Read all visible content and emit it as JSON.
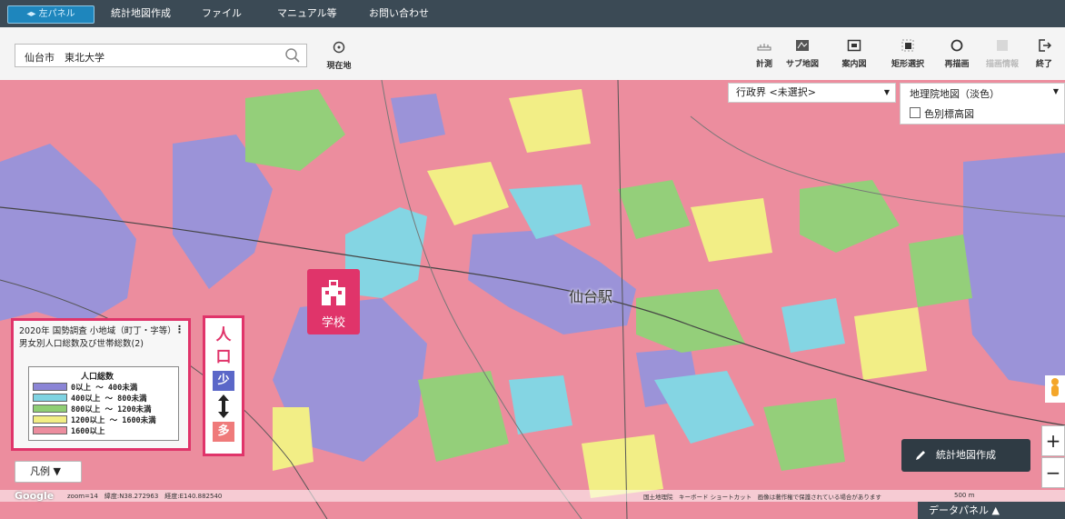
{
  "menu": {
    "left_panel": "◂▸ 左パネル",
    "items": [
      "統計地図作成",
      "ファイル",
      "マニュアル等",
      "お問い合わせ"
    ]
  },
  "search": {
    "value": "仙台市　東北大学",
    "current_location": "現在地"
  },
  "tools": [
    "計測",
    "サブ地図",
    "案内図",
    "矩形選択",
    "再描画",
    "描画情報",
    "終了"
  ],
  "map": {
    "admin_select": "行政界 <未選択>",
    "basemap_select": "地理院地図（淡色）",
    "checkbox_label": "色別標高図",
    "station_label": "仙台駅",
    "school_label": "学校"
  },
  "legend": {
    "title": "2020年 国勢調査 小地域（町丁・字等）男女別人口総数及び世帯総数(2)",
    "heading": "人口総数",
    "rows": [
      {
        "label": "0以上 ～ 400未満",
        "color": "#8b85d6"
      },
      {
        "label": "400以上 ～ 800未満",
        "color": "#7fd3e2"
      },
      {
        "label": "800以上 ～ 1200未満",
        "color": "#8fce74"
      },
      {
        "label": "1200以上 ～ 1600未満",
        "color": "#f2ee84"
      },
      {
        "label": "1600以上",
        "color": "#ec8d9e"
      }
    ],
    "toggle": "凡例 ▼"
  },
  "population_annotation": {
    "chars": [
      "人",
      "口"
    ],
    "low": "少",
    "high": "多",
    "low_color": "#5b67c8",
    "high_color": "#ef7a7a"
  },
  "make_map_button": "統計地図作成",
  "footer": {
    "google": "Google",
    "readout": "zoom=14　緯度:N38.272963　経度:E140.882540",
    "attribution": "国土地理院　キーボード ショートカット　画像は著作権で保護されている場合があります",
    "scale": "500 m",
    "data_panel": "データパネル ▲"
  },
  "colors": {
    "accent": "#e0346a",
    "topbar": "#3b4a55"
  }
}
